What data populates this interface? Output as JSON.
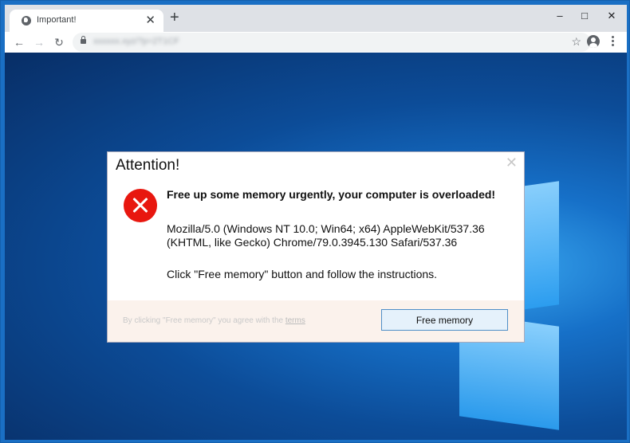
{
  "browser": {
    "tab": {
      "title": "Important!",
      "favicon": "globe-icon",
      "close_icon": "close-icon"
    },
    "new_tab_label": "+",
    "window_controls": {
      "minimize": "–",
      "maximize": "□",
      "close": "✕"
    },
    "nav": {
      "back": "←",
      "forward": "→",
      "reload": "↻"
    },
    "url": "xxxxxx.xyz/?p=2T1CF",
    "star": "☆"
  },
  "dialog": {
    "title": "Attention!",
    "close": "✕",
    "headline": "Free up some memory urgently, your computer is overloaded!",
    "user_agent": "Mozilla/5.0 (Windows NT 10.0; Win64; x64) AppleWebKit/537.36 (KHTML, like Gecko) Chrome/79.0.3945.130 Safari/537.36",
    "instruction": "Click \"Free memory\" button and follow the instructions.",
    "terms_prefix": "By clicking \"Free memory\" you agree with the ",
    "terms_link": "terms",
    "button_label": "Free memory"
  }
}
